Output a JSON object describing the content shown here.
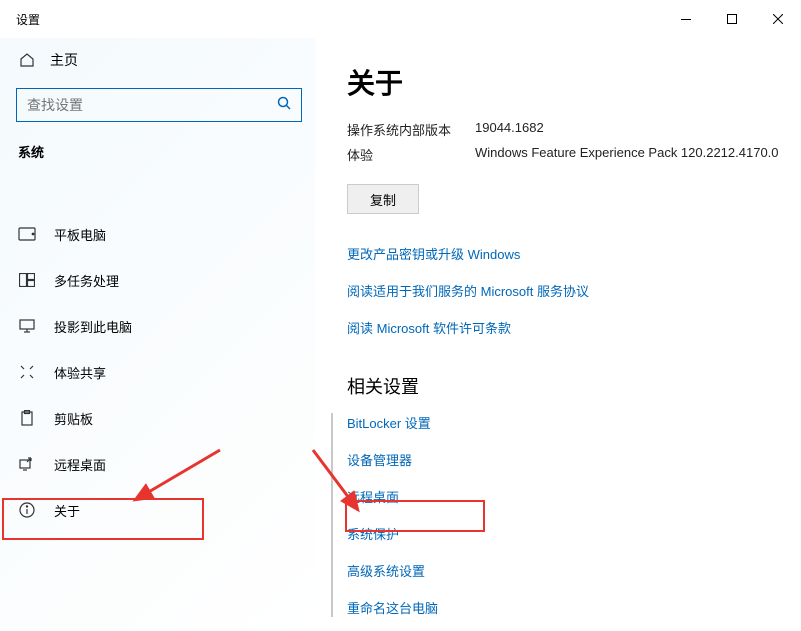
{
  "window": {
    "title": "设置"
  },
  "sidebar": {
    "home": "主页",
    "search_placeholder": "查找设置",
    "section": "系统",
    "items": [
      {
        "label": "平板电脑"
      },
      {
        "label": "多任务处理"
      },
      {
        "label": "投影到此电脑"
      },
      {
        "label": "体验共享"
      },
      {
        "label": "剪贴板"
      },
      {
        "label": "远程桌面"
      },
      {
        "label": "关于"
      }
    ]
  },
  "main": {
    "title": "关于",
    "os_build_label": "操作系统内部版本",
    "os_build_value": "19044.1682",
    "experience_label": "体验",
    "experience_value": "Windows Feature Experience Pack 120.2212.4170.0",
    "copy_label": "复制",
    "links": [
      "更改产品密钥或升级 Windows",
      "阅读适用于我们服务的 Microsoft 服务协议",
      "阅读 Microsoft 软件许可条款"
    ],
    "related_title": "相关设置",
    "related": [
      "BitLocker 设置",
      "设备管理器",
      "远程桌面",
      "系统保护",
      "高级系统设置",
      "重命名这台电脑"
    ]
  }
}
